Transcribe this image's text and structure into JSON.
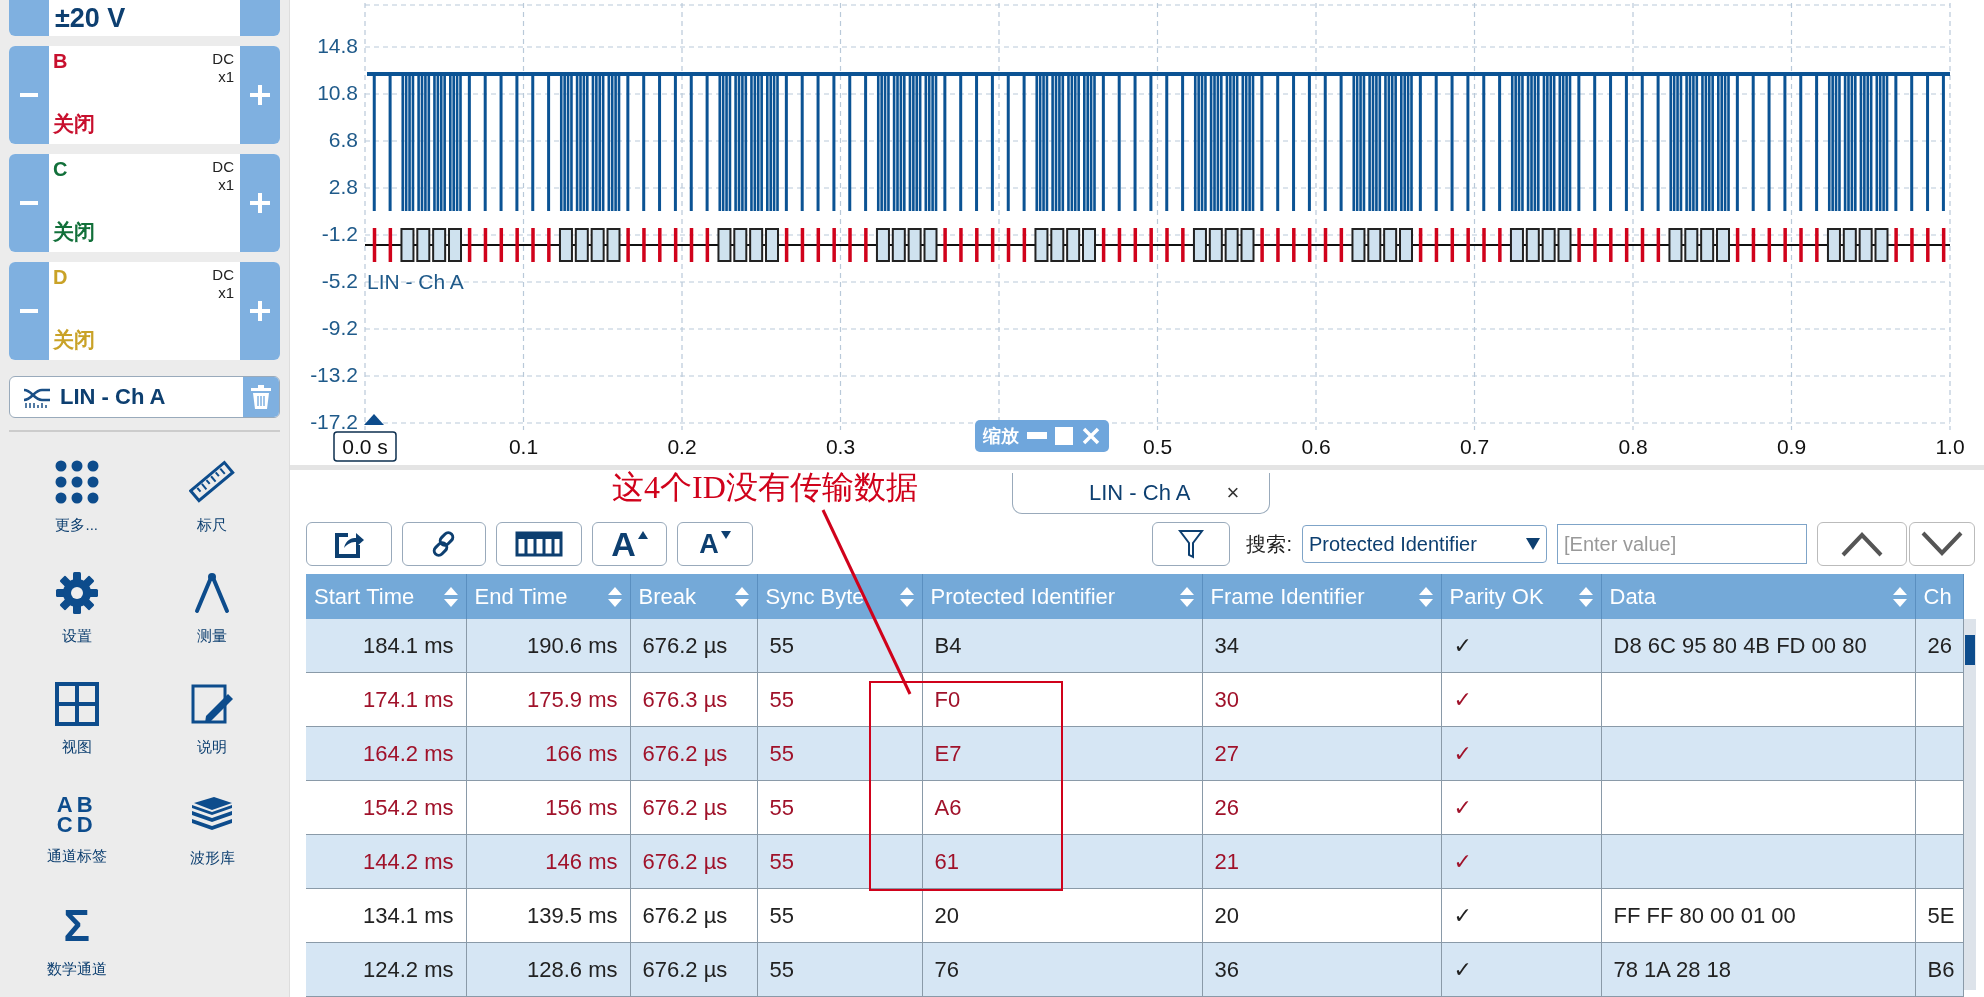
{
  "channel_a": {
    "range": "±20 V"
  },
  "channels": [
    {
      "name": "B",
      "coupling": "DC",
      "probe": "x1",
      "state": "关闭",
      "color": "#c8102e"
    },
    {
      "name": "C",
      "coupling": "DC",
      "probe": "x1",
      "state": "关闭",
      "color": "#12703a"
    },
    {
      "name": "D",
      "coupling": "DC",
      "probe": "x1",
      "state": "关闭",
      "color": "#c9a227"
    }
  ],
  "decoder": {
    "label": "LIN - Ch A"
  },
  "tools": [
    {
      "kind": "more",
      "label": "更多..."
    },
    {
      "kind": "ruler",
      "label": "标尺"
    },
    {
      "kind": "settings",
      "label": "设置"
    },
    {
      "kind": "measure",
      "label": "测量"
    },
    {
      "kind": "view",
      "label": "视图"
    },
    {
      "kind": "notes",
      "label": "说明"
    },
    {
      "kind": "labels",
      "label": "通道标签",
      "glyph": [
        "AB",
        "CD"
      ]
    },
    {
      "kind": "library",
      "label": "波形库"
    },
    {
      "kind": "math",
      "label": "数学通道",
      "glyph": "Σ"
    }
  ],
  "scope": {
    "y_ticks": [
      "14.8",
      "10.8",
      "6.8",
      "2.8",
      "-1.2",
      "-5.2",
      "-9.2",
      "-13.2",
      "-17.2"
    ],
    "x_ticks": [
      "0.0 s",
      "0.1",
      "0.2",
      "0.3",
      "0.5",
      "0.6",
      "0.7",
      "0.8",
      "0.9",
      "1.0"
    ],
    "trace_label": "LIN - Ch A",
    "zoom_toolbar": {
      "label": "缩放"
    }
  },
  "decoder_panel": {
    "tab": {
      "label": "LIN - Ch A",
      "close": "×"
    },
    "toolbar": [
      {
        "kind": "export"
      },
      {
        "kind": "link"
      },
      {
        "kind": "columns"
      },
      {
        "kind": "font_up",
        "text": "A"
      },
      {
        "kind": "font_down",
        "text": "A"
      }
    ],
    "search": {
      "label": "搜索:",
      "column": "Protected Identifier",
      "placeholder": "[Enter value]"
    },
    "table": {
      "columns": [
        {
          "label": "Start Time",
          "sortable": true
        },
        {
          "label": "End Time",
          "sortable": true
        },
        {
          "label": "Break",
          "sortable": true
        },
        {
          "label": "Sync Byte",
          "sortable": true
        },
        {
          "label": "Protected Identifier",
          "sortable": true
        },
        {
          "label": "Frame Identifier",
          "sortable": true
        },
        {
          "label": "Parity OK",
          "sortable": true
        },
        {
          "label": "Data",
          "sortable": true
        },
        {
          "label": "Ch",
          "sortable": false
        }
      ],
      "rows": [
        {
          "flagged": false,
          "cells": [
            "184.1 ms",
            "190.6 ms",
            "676.2 µs",
            "55",
            "B4",
            "34",
            "✓",
            "D8 6C 95 80 4B FD 00 80",
            "26"
          ]
        },
        {
          "flagged": true,
          "cells": [
            "174.1 ms",
            "175.9 ms",
            "676.3 µs",
            "55",
            "F0",
            "30",
            "✓",
            null,
            null
          ]
        },
        {
          "flagged": true,
          "cells": [
            "164.2 ms",
            "166 ms",
            "676.2 µs",
            "55",
            "E7",
            "27",
            "✓",
            null,
            null
          ]
        },
        {
          "flagged": true,
          "cells": [
            "154.2 ms",
            "156 ms",
            "676.2 µs",
            "55",
            "A6",
            "26",
            "✓",
            null,
            null
          ]
        },
        {
          "flagged": true,
          "cells": [
            "144.2 ms",
            "146 ms",
            "676.2 µs",
            "55",
            "61",
            "21",
            "✓",
            null,
            null
          ]
        },
        {
          "flagged": false,
          "cells": [
            "134.1 ms",
            "139.5 ms",
            "676.2 µs",
            "55",
            "20",
            "20",
            "✓",
            "FF FF 80 00 01 00",
            "5E"
          ]
        },
        {
          "flagged": false,
          "cells": [
            "124.2 ms",
            "128.6 ms",
            "676.2 µs",
            "55",
            "76",
            "36",
            "✓",
            "78 1A 28 18",
            "B6"
          ]
        }
      ]
    }
  },
  "annotation": {
    "text": "这4个ID没有传输数据"
  }
}
